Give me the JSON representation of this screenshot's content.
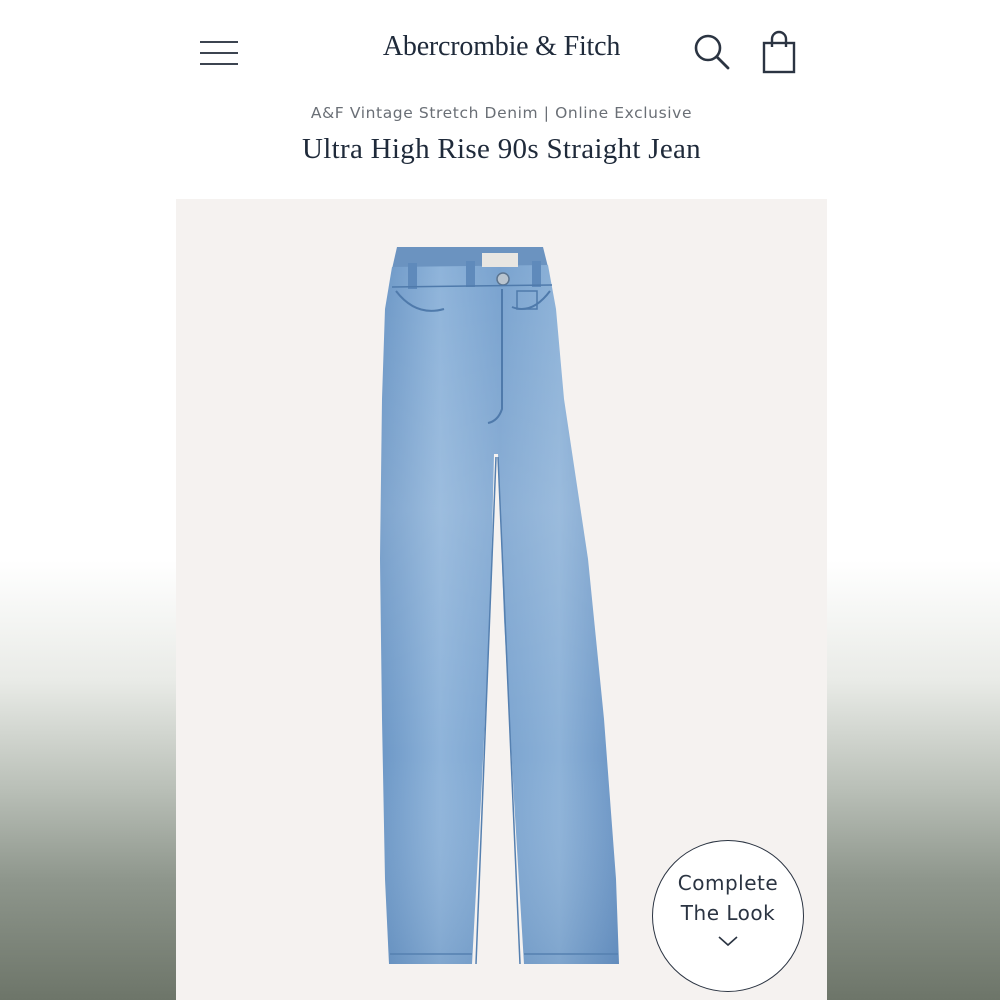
{
  "header": {
    "brand": "Abercrombie & Fitch",
    "menu_icon": "hamburger-menu-icon",
    "search_icon": "search-icon",
    "bag_icon": "shopping-bag-icon"
  },
  "product": {
    "collection": "A&F Vintage Stretch Denim | Online Exclusive",
    "title": "Ultra High Rise 90s Straight Jean",
    "image": "light-wash-straight-jeans"
  },
  "complete_look": {
    "line1": "Complete",
    "line2": "The Look",
    "icon": "chevron-down-icon"
  },
  "colors": {
    "text_dark": "#1f2a3a",
    "text_muted": "#6a6f76",
    "denim": "#7aa3cf",
    "background": "#f5f2f0"
  }
}
